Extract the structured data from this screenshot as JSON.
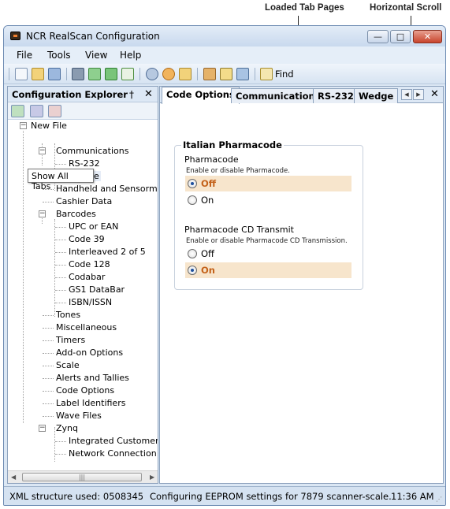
{
  "annotations": {
    "loaded_tab_pages": "Loaded Tab Pages",
    "horizontal_scroll": "Horizontal Scroll"
  },
  "window": {
    "title": "NCR RealScan Configuration",
    "icon": "scanner-app-icon"
  },
  "menu": [
    "File",
    "Tools",
    "View",
    "Help"
  ],
  "toolbar": {
    "find_label": "Find",
    "icons": [
      "new-file-icon",
      "open-icon",
      "save-all-icon",
      "print-icon",
      "export-icon",
      "refresh-icon",
      "upload-icon",
      "scanner-icon",
      "tones-icon",
      "settings-icon",
      "wrench-icon",
      "edit-icon",
      "network-icon",
      "find-icon"
    ]
  },
  "explorer": {
    "title": "Configuration Explorer",
    "tooltip": "Show All Tabs",
    "tree": {
      "root": "New File",
      "communications": "Communications",
      "rs232": "RS-232",
      "wedge": "Wedge",
      "handheld": "Handheld and Sensormatic",
      "cashier": "Cashier Data",
      "barcodes": "Barcodes",
      "upc": "UPC or EAN",
      "code39": "Code 39",
      "i2of5": "Interleaved 2 of 5",
      "code128": "Code 128",
      "codabar": "Codabar",
      "gs1": "GS1 DataBar",
      "isbn": "ISBN/ISSN",
      "tones": "Tones",
      "misc": "Miscellaneous",
      "timers": "Timers",
      "addon": "Add-on Options",
      "scale": "Scale",
      "alerts": "Alerts and Tallies",
      "codeoptions": "Code Options",
      "labelids": "Label Identifiers",
      "wave": "Wave Files",
      "zynq": "Zynq",
      "integrated": "Integrated Customer Sca",
      "network": "Network Connection"
    }
  },
  "tabs": [
    "Code Options",
    "Communications",
    "RS-232",
    "Wedge"
  ],
  "panel": {
    "group_title": "Italian Pharmacode",
    "field1": {
      "label": "Pharmacode",
      "desc": "Enable or disable Pharmacode.",
      "options": [
        "Off",
        "On"
      ],
      "selected": "Off"
    },
    "field2": {
      "label": "Pharmacode CD Transmit",
      "desc": "Enable or disable Pharmacode CD Transmission.",
      "options": [
        "Off",
        "On"
      ],
      "selected": "On"
    }
  },
  "status": {
    "xml": "XML structure used: 0508345",
    "message": "Configuring EEPROM settings for 7879 scanner-scale.",
    "time": "11:36 AM"
  },
  "colors": {
    "selected_option_bg": "#f7e5cc",
    "selected_option_text": "#c4621a",
    "chrome": "#dbe7f4"
  }
}
